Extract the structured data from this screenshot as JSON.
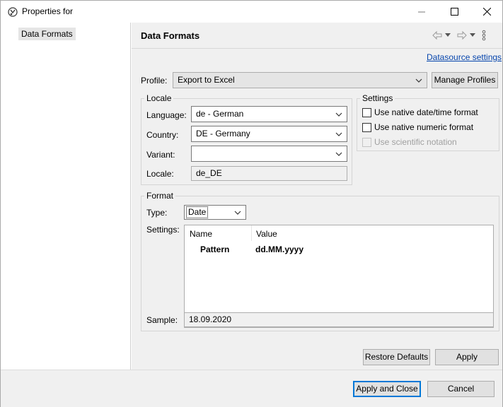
{
  "window": {
    "title": "Properties for",
    "controls": {
      "minimize": "minimize",
      "maximize": "maximize",
      "close": "close"
    }
  },
  "tree": {
    "items": [
      {
        "label": "Data Formats",
        "selected": true
      }
    ]
  },
  "page": {
    "title": "Data Formats",
    "datasource_link": "Datasource settings",
    "profile": {
      "label": "Profile:",
      "value": "Export to Excel",
      "manage_button": "Manage Profiles"
    },
    "locale": {
      "group_title": "Locale",
      "language_label": "Language:",
      "language_value": "de - German",
      "country_label": "Country:",
      "country_value": "DE - Germany",
      "variant_label": "Variant:",
      "variant_value": "",
      "locale_label": "Locale:",
      "locale_value": "de_DE"
    },
    "settings": {
      "group_title": "Settings",
      "options": [
        {
          "label": "Use native date/time format",
          "checked": false,
          "enabled": true
        },
        {
          "label": "Use native numeric format",
          "checked": false,
          "enabled": true
        },
        {
          "label": "Use scientific notation",
          "checked": false,
          "enabled": false
        }
      ]
    },
    "format": {
      "group_title": "Format",
      "type_label": "Type:",
      "type_value": "Date",
      "settings_label": "Settings:",
      "columns": [
        "Name",
        "Value"
      ],
      "rows": [
        {
          "name": "Pattern",
          "value": "dd.MM.yyyy"
        }
      ],
      "sample_label": "Sample:",
      "sample_value": "18.09.2020"
    },
    "restore_defaults_button": "Restore Defaults",
    "apply_button": "Apply"
  },
  "footer": {
    "apply_close_button": "Apply and Close",
    "cancel_button": "Cancel"
  },
  "colors": {
    "link": "#0645ad",
    "default_button_border": "#0078d7",
    "panel_bg": "#f0f0f0"
  },
  "icons": [
    "app-icon",
    "back-icon",
    "forward-icon",
    "menu-dots-icon",
    "dropdown-arrow-icon"
  ]
}
